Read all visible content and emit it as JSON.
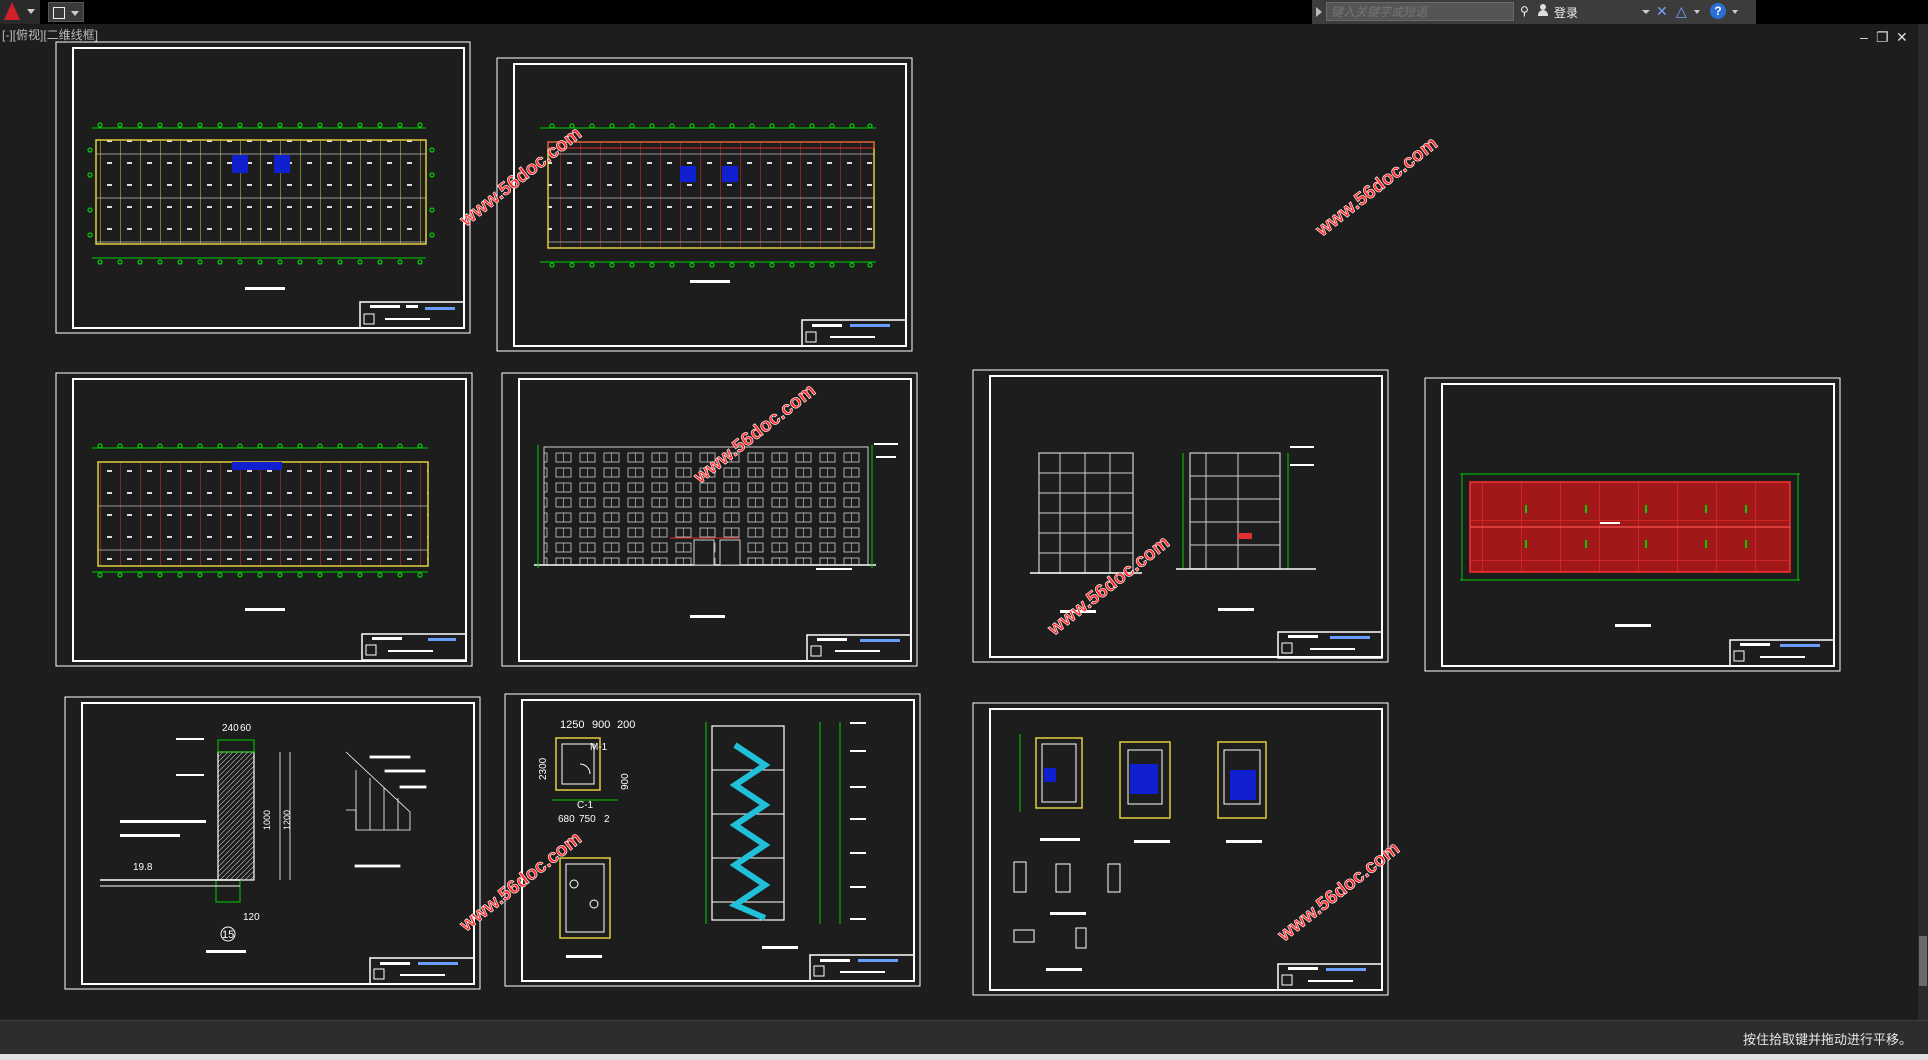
{
  "app": {
    "menu_button_icon": "autocad-logo-icon",
    "quick_access_icon": "workspace-icon"
  },
  "infocenter": {
    "search_placeholder": "键入关键字或短语",
    "search_icon": "binoculars-icon",
    "user_icon": "user-icon",
    "login_label": "登录",
    "exchange_icon": "exchange-x-icon",
    "stay_connected_icon": "stay-connected-icon",
    "help_label": "?"
  },
  "viewport": {
    "label": "[-][俯视][二维线框]"
  },
  "window_controls": {
    "minimize": "–",
    "restore": "❐",
    "close": "✕"
  },
  "watermark": "www.56doc.com",
  "drawings": [
    {
      "id": "floor-plan-1",
      "kind": "floorplan"
    },
    {
      "id": "floor-plan-2",
      "kind": "floorplan"
    },
    {
      "id": "floor-plan-3",
      "kind": "floorplan"
    },
    {
      "id": "elevation-front",
      "kind": "elevation"
    },
    {
      "id": "elevation-side",
      "kind": "side"
    },
    {
      "id": "roof-plan",
      "kind": "roof"
    },
    {
      "id": "parapet-detail",
      "kind": "detail",
      "labels": [
        "240",
        "60",
        "15",
        "120",
        "19.8",
        "1000",
        "1200"
      ]
    },
    {
      "id": "stair-detail",
      "kind": "stair",
      "labels": [
        "1250",
        "900",
        "200",
        "M-1",
        "2300",
        "900",
        "C-1",
        "680",
        "750",
        "2"
      ]
    },
    {
      "id": "toilet-detail",
      "kind": "toilet"
    }
  ],
  "status": {
    "message": "按住拾取键并拖动进行平移。"
  },
  "colors": {
    "canvas": "#1d1d1d",
    "frame": "#ffffff",
    "axis": "#00d000",
    "wall": "#e03030",
    "watermark": "#ff2a2a"
  }
}
